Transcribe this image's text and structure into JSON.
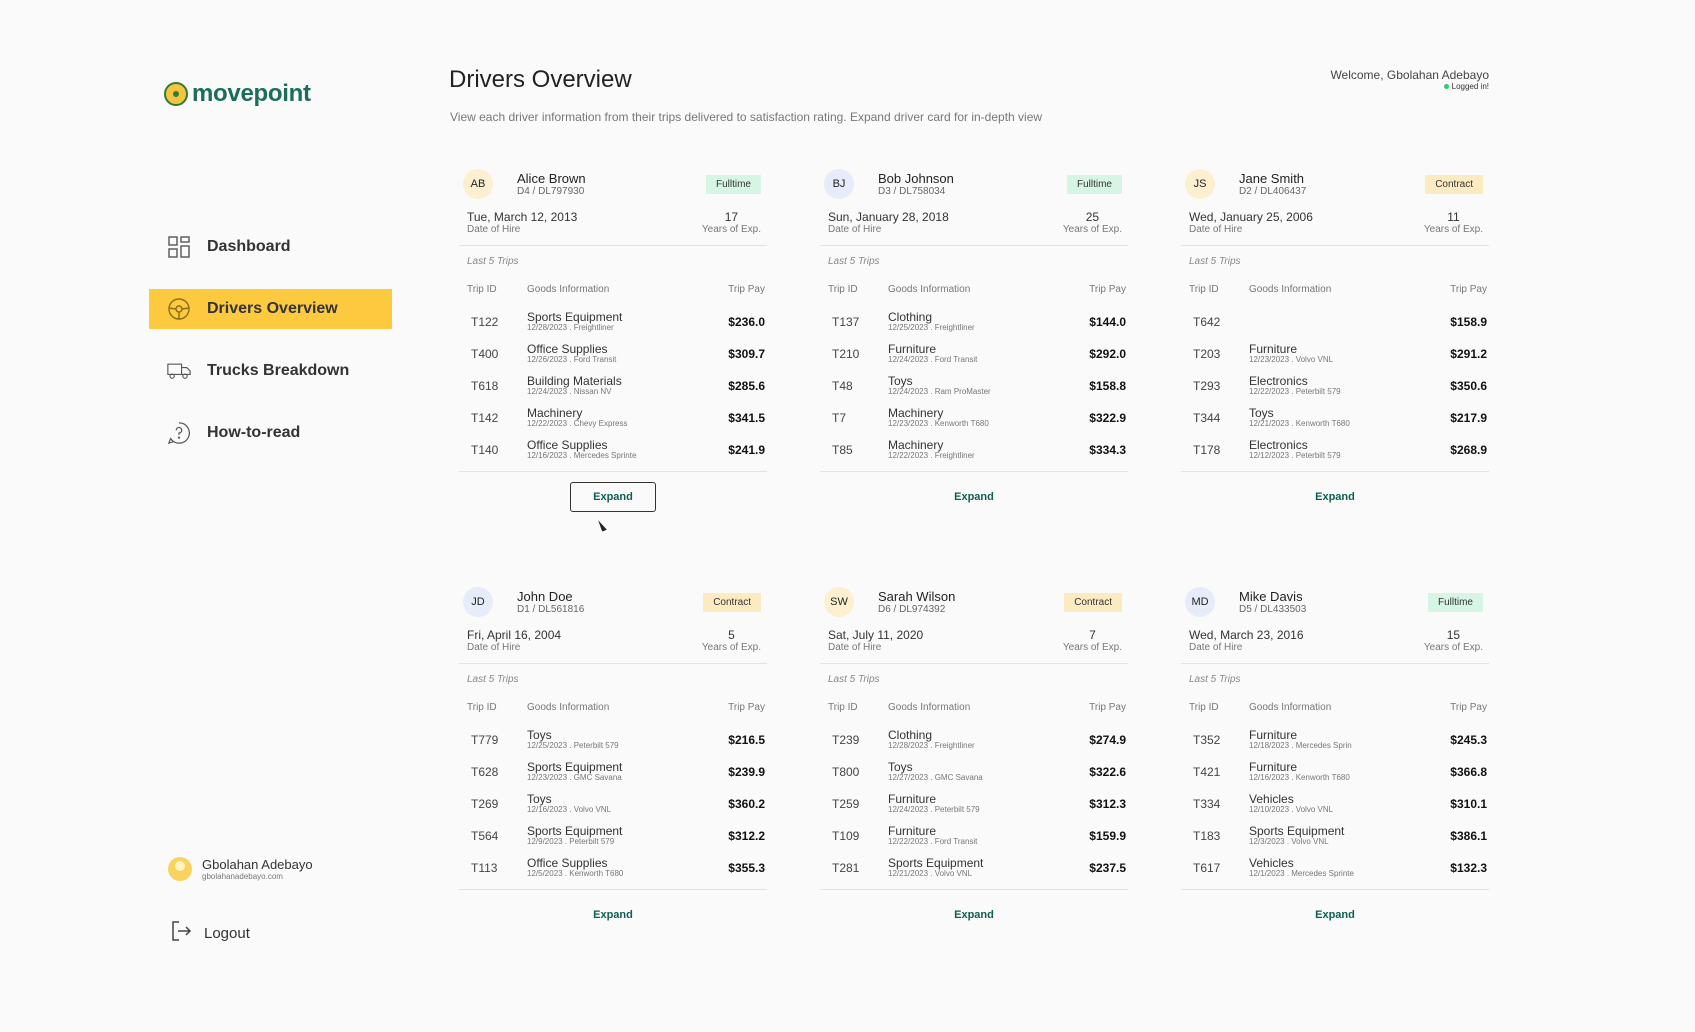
{
  "brand": {
    "name": "movepoint"
  },
  "sidebar": {
    "items": [
      {
        "label": "Dashboard",
        "icon": "grid-icon"
      },
      {
        "label": "Drivers Overview",
        "icon": "steering-wheel-icon",
        "active": true
      },
      {
        "label": "Trucks Breakdown",
        "icon": "truck-icon"
      },
      {
        "label": "How-to-read",
        "icon": "help-chat-icon"
      }
    ],
    "user": {
      "name": "Gbolahan Adebayo",
      "email": "gbolahanadebayo.com"
    },
    "logout_label": "Logout"
  },
  "header": {
    "title": "Drivers Overview",
    "subtitle": "View each driver information from their trips delivered to satisfaction rating. Expand driver card for in-depth view",
    "welcome": "Welcome, Gbolahan Adebayo",
    "status": "Logged in!"
  },
  "labels": {
    "date_of_hire": "Date of Hire",
    "years_of_exp": "Years of Exp.",
    "last_trips": "Last 5 Trips",
    "col_trip_id": "Trip ID",
    "col_goods": "Goods Information",
    "col_pay": "Trip Pay",
    "expand": "Expand"
  },
  "colors": {
    "accent": "#fcc93f",
    "brand": "#1b6e5a",
    "fulltime": "#d7f5e4",
    "contract": "#fcebc1"
  },
  "drivers": [
    {
      "initials": "AB",
      "name": "Alice Brown",
      "id": "D4 / DL797930",
      "type": "Fulltime",
      "hire_date": "Tue, March 12, 2013",
      "years": "17",
      "trips": [
        {
          "id": "T122",
          "goods": "Sports Equipment",
          "meta": "12/28/2023 . Freightliner",
          "pay": "$236.0"
        },
        {
          "id": "T400",
          "goods": "Office Supplies",
          "meta": "12/26/2023 . Ford Transit",
          "pay": "$309.7"
        },
        {
          "id": "T618",
          "goods": "Building Materials",
          "meta": "12/24/2023 . Nissan NV",
          "pay": "$285.6"
        },
        {
          "id": "T142",
          "goods": "Machinery",
          "meta": "12/22/2023 . Chevy Express",
          "pay": "$341.5"
        },
        {
          "id": "T140",
          "goods": "Office Supplies",
          "meta": "12/16/2023 . Mercedes Sprinte",
          "pay": "$241.9"
        }
      ]
    },
    {
      "initials": "BJ",
      "name": "Bob Johnson",
      "id": "D3 / DL758034",
      "type": "Fulltime",
      "hire_date": "Sun, January 28, 2018",
      "years": "25",
      "trips": [
        {
          "id": "T137",
          "goods": "Clothing",
          "meta": "12/25/2023 . Freightliner",
          "pay": "$144.0"
        },
        {
          "id": "T210",
          "goods": "Furniture",
          "meta": "12/24/2023 . Ford Transit",
          "pay": "$292.0"
        },
        {
          "id": "T48",
          "goods": "Toys",
          "meta": "12/24/2023 . Ram ProMaster",
          "pay": "$158.8"
        },
        {
          "id": "T7",
          "goods": "Machinery",
          "meta": "12/23/2023 . Kenworth T680",
          "pay": "$322.9"
        },
        {
          "id": "T85",
          "goods": "Machinery",
          "meta": "12/22/2023 . Freightliner",
          "pay": "$334.3"
        }
      ]
    },
    {
      "initials": "JS",
      "name": "Jane Smith",
      "id": "D2 / DL406437",
      "type": "Contract",
      "hire_date": "Wed, January 25, 2006",
      "years": "11",
      "trips": [
        {
          "id": "T642",
          "goods": "",
          "meta": "",
          "pay": "$158.9"
        },
        {
          "id": "T203",
          "goods": "Furniture",
          "meta": "12/23/2023 . Volvo VNL",
          "pay": "$291.2"
        },
        {
          "id": "T293",
          "goods": "Electronics",
          "meta": "12/22/2023 . Peterbilt 579",
          "pay": "$350.6"
        },
        {
          "id": "T344",
          "goods": "Toys",
          "meta": "12/21/2023 . Kenworth T680",
          "pay": "$217.9"
        },
        {
          "id": "T178",
          "goods": "Electronics",
          "meta": "12/12/2023 . Peterbilt 579",
          "pay": "$268.9"
        }
      ]
    },
    {
      "initials": "JD",
      "name": "John Doe",
      "id": "D1 / DL561816",
      "type": "Contract",
      "hire_date": "Fri, April 16, 2004",
      "years": "5",
      "trips": [
        {
          "id": "T779",
          "goods": "Toys",
          "meta": "12/25/2023 . Peterbilt 579",
          "pay": "$216.5"
        },
        {
          "id": "T628",
          "goods": "Sports Equipment",
          "meta": "12/23/2023 . GMC Savana",
          "pay": "$239.9"
        },
        {
          "id": "T269",
          "goods": "Toys",
          "meta": "12/16/2023 . Volvo VNL",
          "pay": "$360.2"
        },
        {
          "id": "T564",
          "goods": "Sports Equipment",
          "meta": "12/9/2023 . Peterbilt 579",
          "pay": "$312.2"
        },
        {
          "id": "T113",
          "goods": "Office Supplies",
          "meta": "12/5/2023 . Kenworth T680",
          "pay": "$355.3"
        }
      ]
    },
    {
      "initials": "SW",
      "name": "Sarah Wilson",
      "id": "D6 / DL974392",
      "type": "Contract",
      "hire_date": "Sat, July 11, 2020",
      "years": "7",
      "trips": [
        {
          "id": "T239",
          "goods": "Clothing",
          "meta": "12/28/2023 . Freightliner",
          "pay": "$274.9"
        },
        {
          "id": "T800",
          "goods": "Toys",
          "meta": "12/27/2023 . GMC Savana",
          "pay": "$322.6"
        },
        {
          "id": "T259",
          "goods": "Furniture",
          "meta": "12/24/2023 . Peterbilt 579",
          "pay": "$312.3"
        },
        {
          "id": "T109",
          "goods": "Furniture",
          "meta": "12/22/2023 . Ford Transit",
          "pay": "$159.9"
        },
        {
          "id": "T281",
          "goods": "Sports Equipment",
          "meta": "12/21/2023 . Volvo VNL",
          "pay": "$237.5"
        }
      ]
    },
    {
      "initials": "MD",
      "name": "Mike Davis",
      "id": "D5 / DL433503",
      "type": "Fulltime",
      "hire_date": "Wed, March 23, 2016",
      "years": "15",
      "trips": [
        {
          "id": "T352",
          "goods": "Furniture",
          "meta": "12/18/2023 . Mercedes Sprin",
          "pay": "$245.3"
        },
        {
          "id": "T421",
          "goods": "Furniture",
          "meta": "12/16/2023 . Kenworth T680",
          "pay": "$366.8"
        },
        {
          "id": "T334",
          "goods": "Vehicles",
          "meta": "12/10/2023 . Volvo VNL",
          "pay": "$310.1"
        },
        {
          "id": "T183",
          "goods": "Sports Equipment",
          "meta": "12/3/2023 . Volvo VNL",
          "pay": "$386.1"
        },
        {
          "id": "T617",
          "goods": "Vehicles",
          "meta": "12/1/2023 . Mercedes Sprinte",
          "pay": "$132.3"
        }
      ]
    }
  ]
}
